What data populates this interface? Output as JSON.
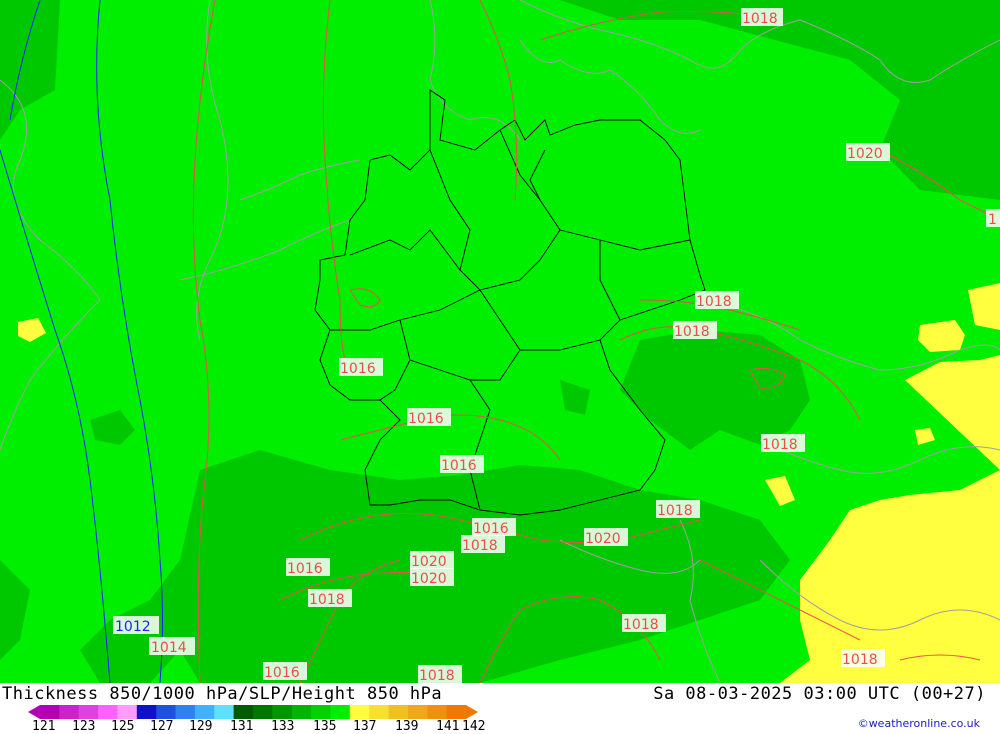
{
  "map": {
    "title": "Thickness 850/1000 hPa/SLP/Height 850 hPa",
    "datetime": "Sa 08-03-2025 03:00 UTC (00+27)",
    "credit": "©weatheronline.co.uk",
    "colors": {
      "background_green": "#00ee00",
      "dark_green": "#00c800",
      "yellow": "#ffff40",
      "isobar": "#e8504a",
      "border": "#000000",
      "coast": "#a0a0a0",
      "blue_isobar": "#2020ff"
    },
    "isobar_labels": [
      {
        "text": "1018",
        "color": "#e8504a"
      },
      {
        "text": "1020",
        "color": "#e8504a"
      },
      {
        "text": "1",
        "color": "#e8504a"
      },
      {
        "text": "1018",
        "color": "#e8504a"
      },
      {
        "text": "1018",
        "color": "#e8504a"
      },
      {
        "text": "1016",
        "color": "#e8504a"
      },
      {
        "text": "1016",
        "color": "#e8504a"
      },
      {
        "text": "1016",
        "color": "#e8504a"
      },
      {
        "text": "1018",
        "color": "#e8504a"
      },
      {
        "text": "1018",
        "color": "#e8504a"
      },
      {
        "text": "1016",
        "color": "#e8504a"
      },
      {
        "text": "1018",
        "color": "#e8504a"
      },
      {
        "text": "1020",
        "color": "#e8504a"
      },
      {
        "text": "1020",
        "color": "#e8504a"
      },
      {
        "text": "1020",
        "color": "#e8504a"
      },
      {
        "text": "1016",
        "color": "#e8504a"
      },
      {
        "text": "1018",
        "color": "#e8504a"
      },
      {
        "text": "1012",
        "color": "#2020ff"
      },
      {
        "text": "1014",
        "color": "#e8504a"
      },
      {
        "text": "1018",
        "color": "#e8504a"
      },
      {
        "text": "1016",
        "color": "#e8504a"
      },
      {
        "text": "1018",
        "color": "#e8504a"
      },
      {
        "text": "1018",
        "color": "#e8504a"
      }
    ],
    "colorbar": {
      "colors": [
        "#b200b2",
        "#cc22cc",
        "#e040e0",
        "#ff60ff",
        "#ff9cff",
        "#1010c8",
        "#2050e0",
        "#3080f0",
        "#40b0ff",
        "#60e0ff",
        "#005a00",
        "#007800",
        "#009600",
        "#00b400",
        "#00d200",
        "#00ee00",
        "#ffff40",
        "#f7e030",
        "#f0c020",
        "#f0a818",
        "#f09010",
        "#f07800"
      ],
      "ticks": [
        "121",
        "123",
        "125",
        "127",
        "129",
        "131",
        "133",
        "135",
        "137",
        "139",
        "141",
        "142"
      ]
    }
  }
}
